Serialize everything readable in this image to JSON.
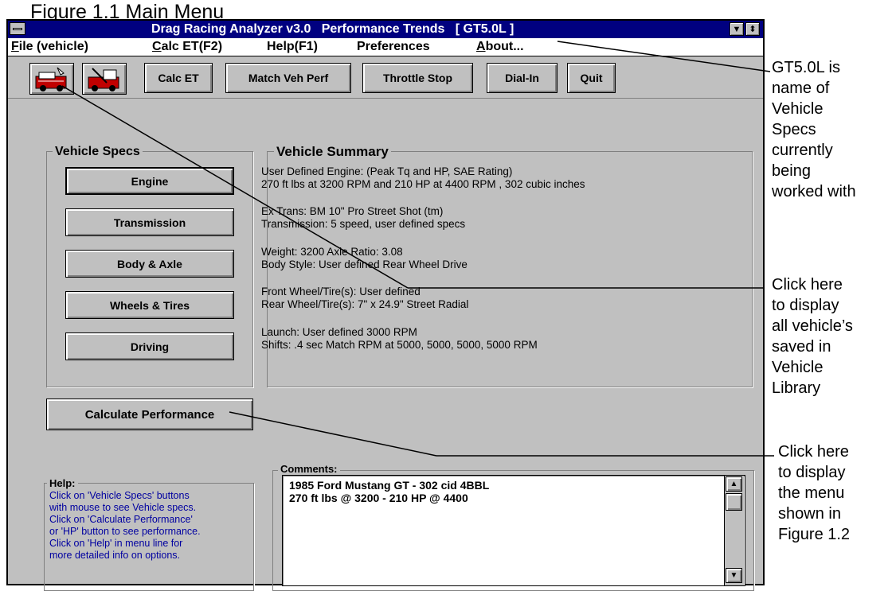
{
  "figure_title": "Figure 1.1  Main Menu",
  "window": {
    "title": "Drag Racing Analyzer v3.0   Performance Trends   [ GT5.0L ]",
    "scroll_down_glyph": "▼",
    "scroll_updown_glyph": "⬍"
  },
  "menu": {
    "file": {
      "accel": "F",
      "rest": "ile (vehicle)"
    },
    "calc": {
      "accel": "C",
      "rest": "alc ET(F2)"
    },
    "help": "Help(F1)",
    "preferences": "Preferences",
    "about": {
      "accel": "A",
      "rest": "bout..."
    }
  },
  "toolbar": {
    "calc_et": "Calc ET",
    "match_veh_perf": "Match Veh Perf",
    "throttle_stop": "Throttle Stop",
    "dial_in": "Dial-In",
    "quit": "Quit"
  },
  "vehicle_specs": {
    "label": "Vehicle Specs",
    "buttons": [
      "Engine",
      "Transmission",
      "Body & Axle",
      "Wheels & Tires",
      "Driving"
    ]
  },
  "vehicle_summary": {
    "label": "Vehicle Summary",
    "lines": [
      "User Defined Engine: (Peak Tq and HP, SAE Rating)",
      "270 ft lbs at 3200 RPM  and  210 HP at 4400 RPM , 302 cubic inches",
      "Ex Trans: BM 10\" Pro Street Shot (tm)",
      "Transmission:   5 speed, user defined specs",
      "Weight: 3200         Axle Ratio: 3.08",
      "Body Style:  User defined Rear Wheel Drive",
      "Front Wheel/Tire(s):  User defined",
      "Rear Wheel/Tire(s):  7\" x 24.9\" Street Radial",
      "Launch:  User defined 3000 RPM",
      "Shifts:  .4 sec Match RPM at  5000, 5000, 5000, 5000 RPM"
    ]
  },
  "calculate_button": "Calculate Performance",
  "help_panel": {
    "label": "Help:",
    "lines": [
      "Click on 'Vehicle Specs' buttons",
      "with mouse to see Vehicle specs.",
      "Click on 'Calculate Performance'",
      "or 'HP' button to see performance.",
      " Click on 'Help' in menu line for",
      "more detailed info on options."
    ]
  },
  "comments": {
    "label": "Comments:",
    "lines": [
      "1985 Ford Mustang GT - 302 cid 4BBL",
      "270 ft lbs @ 3200 - 210 HP @ 4400"
    ],
    "scroll_up_glyph": "▲",
    "scroll_down_glyph": "▼"
  },
  "annotations": {
    "vehicle_name": [
      "GT5.0L is",
      "name of",
      "Vehicle",
      "Specs",
      "currently",
      "being",
      "worked with"
    ],
    "library": [
      "Click here",
      "to display",
      "all vehicle’s",
      "saved in",
      "Vehicle",
      "Library"
    ],
    "menu_figure": [
      "Click here",
      "to display",
      "the menu",
      "shown in",
      "Figure 1.2"
    ]
  }
}
